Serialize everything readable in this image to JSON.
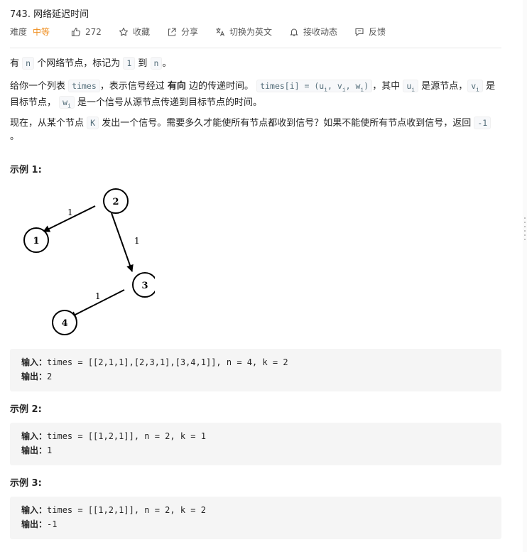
{
  "problem": {
    "title": "743. 网络延迟时间",
    "difficulty_label": "难度",
    "difficulty": "中等",
    "likes": "272",
    "favorite_label": "收藏",
    "share_label": "分享",
    "switch_lang_label": "切换为英文",
    "subscribe_label": "接收动态",
    "feedback_label": "反馈"
  },
  "description": {
    "p1_a": "有 ",
    "p1_n": "n",
    "p1_b": " 个网络节点，标记为 ",
    "p1_one": "1",
    "p1_c": " 到 ",
    "p1_n2": "n",
    "p1_d": "。",
    "p2_a": "给你一个列表 ",
    "p2_times": "times",
    "p2_b": "，表示信号经过 ",
    "p2_bold": "有向",
    "p2_c": " 边的传递时间。 ",
    "p2_code_a": "times[i] = (u",
    "p2_code_sub_i": "i",
    "p2_code_b": ", v",
    "p2_code_c": ", w",
    "p2_code_d": ")",
    "p2_d": "，其中 ",
    "p2_u": "u",
    "p2_e": " 是源节点，",
    "p2_v": "v",
    "p2_f": " 是目标节点， ",
    "p2_w": "w",
    "p2_g": " 是一个信号从源节点传递到目标节点的时间。",
    "p3_a": "现在，从某个节点 ",
    "p3_k": "K",
    "p3_b": " 发出一个信号。需要多久才能使所有节点都收到信号？如果不能使所有节点收到信号，返回 ",
    "p3_neg": "-1",
    "p3_c": " 。"
  },
  "graph": {
    "nodes": [
      "1",
      "2",
      "3",
      "4"
    ],
    "edge_labels": [
      "1",
      "1",
      "1"
    ]
  },
  "examples": [
    {
      "title": "示例 1:",
      "input_label": "输入：",
      "input": "times = [[2,1,1],[2,3,1],[3,4,1]], n = 4, k = 2",
      "output_label": "输出：",
      "output": "2"
    },
    {
      "title": "示例 2:",
      "input_label": "输入：",
      "input": "times = [[1,2,1]], n = 2, k = 1",
      "output_label": "输出：",
      "output": "1"
    },
    {
      "title": "示例 3:",
      "input_label": "输入：",
      "input": "times = [[1,2,1]], n = 2, k = 2",
      "output_label": "输出：",
      "output": "-1"
    }
  ]
}
